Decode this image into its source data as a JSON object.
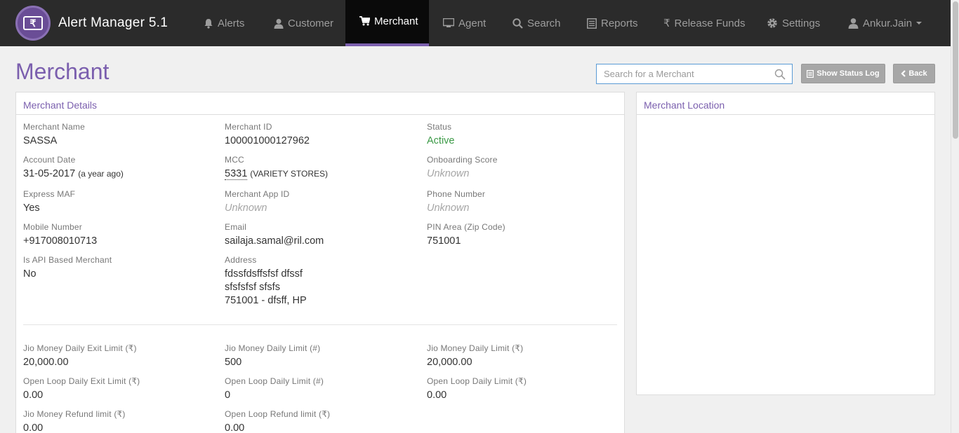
{
  "app": {
    "title": "Alert Manager 5.1",
    "logo_icon": "rupee-card-icon"
  },
  "nav": {
    "alerts": "Alerts",
    "customer": "Customer",
    "merchant": "Merchant",
    "agent": "Agent",
    "search": "Search",
    "reports": "Reports",
    "release_funds": "Release Funds",
    "release_funds_icon": "₹",
    "settings": "Settings",
    "user": "Ankur.Jain",
    "active": "Merchant"
  },
  "page": {
    "title": "Merchant",
    "search_placeholder": "Search for a Merchant",
    "status_log_button": "Show Status Log",
    "back_button": "Back"
  },
  "details": {
    "heading": "Merchant Details",
    "merchant_name": {
      "label": "Merchant Name",
      "value": "SASSA"
    },
    "merchant_id": {
      "label": "Merchant ID",
      "value": "100001000127962"
    },
    "status": {
      "label": "Status",
      "value": "Active"
    },
    "account_date": {
      "label": "Account Date",
      "value": "31-05-2017",
      "relative": "(a year ago)"
    },
    "mcc": {
      "label": "MCC",
      "code": "5331",
      "desc": "(VARIETY STORES)"
    },
    "onboarding_score": {
      "label": "Onboarding Score",
      "value": "Unknown"
    },
    "express_maf": {
      "label": "Express MAF",
      "value": "Yes"
    },
    "merchant_app_id": {
      "label": "Merchant App ID",
      "value": "Unknown"
    },
    "phone_number": {
      "label": "Phone Number",
      "value": "Unknown"
    },
    "mobile_number": {
      "label": "Mobile Number",
      "value": "+917008010713"
    },
    "email": {
      "label": "Email",
      "value": "sailaja.samal@ril.com"
    },
    "pin_area": {
      "label": "PIN Area (Zip Code)",
      "value": "751001"
    },
    "api_based": {
      "label": "Is API Based Merchant",
      "value": "No"
    },
    "address": {
      "label": "Address",
      "line1": "fdssfdsffsfsf dfssf",
      "line2": "sfsfsfsf sfsfs",
      "line3": "751001 - dfsff, HP"
    }
  },
  "limits": {
    "jm_daily_exit": {
      "label": "Jio Money Daily Exit Limit (₹)",
      "value": "20,000.00"
    },
    "jm_daily_count": {
      "label": "Jio Money Daily Limit (#)",
      "value": "500"
    },
    "jm_daily_amount": {
      "label": "Jio Money Daily Limit (₹)",
      "value": "20,000.00"
    },
    "ol_daily_exit": {
      "label": "Open Loop Daily Exit Limit (₹)",
      "value": "0.00"
    },
    "ol_daily_count": {
      "label": "Open Loop Daily Limit (#)",
      "value": "0"
    },
    "ol_daily_amount": {
      "label": "Open Loop Daily Limit (₹)",
      "value": "0.00"
    },
    "jm_refund": {
      "label": "Jio Money Refund limit (₹)",
      "value": "0.00"
    },
    "ol_refund": {
      "label": "Open Loop Refund limit (₹)",
      "value": "0.00"
    }
  },
  "location": {
    "heading": "Merchant Location"
  },
  "colors": {
    "accent": "#7b5fae",
    "active_status": "#3c9a47",
    "navbar": "#2b2b2b"
  }
}
